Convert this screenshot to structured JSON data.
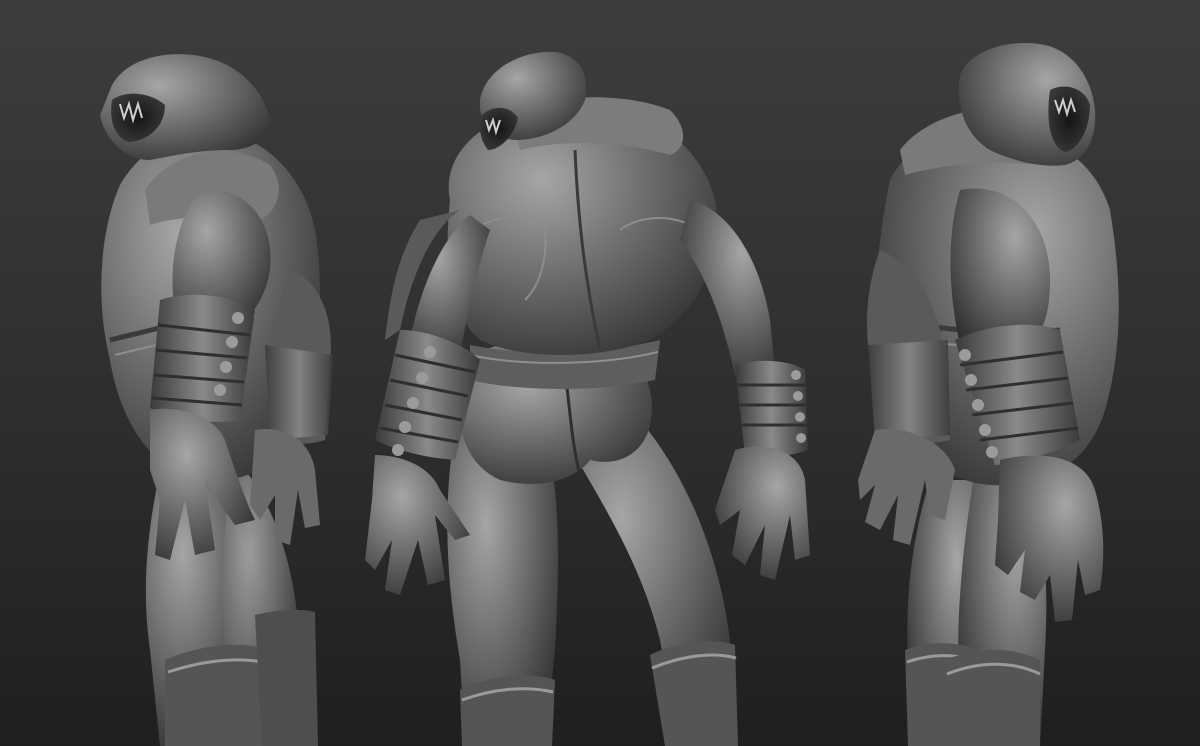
{
  "scene": {
    "background": {
      "top": "#3d3d3d",
      "mid": "#2e2e2e",
      "bottom": "#1f1f1f"
    },
    "material": {
      "highlight": "#a6a6a6",
      "base": "#6e6e6e",
      "shadow": "#2b2b2b",
      "cavity": "#151515"
    },
    "views": [
      {
        "name": "side-view",
        "orientation": "left-profile"
      },
      {
        "name": "back-view",
        "orientation": "rear"
      },
      {
        "name": "three-quarter-view",
        "orientation": "right-three-quarter"
      }
    ]
  }
}
